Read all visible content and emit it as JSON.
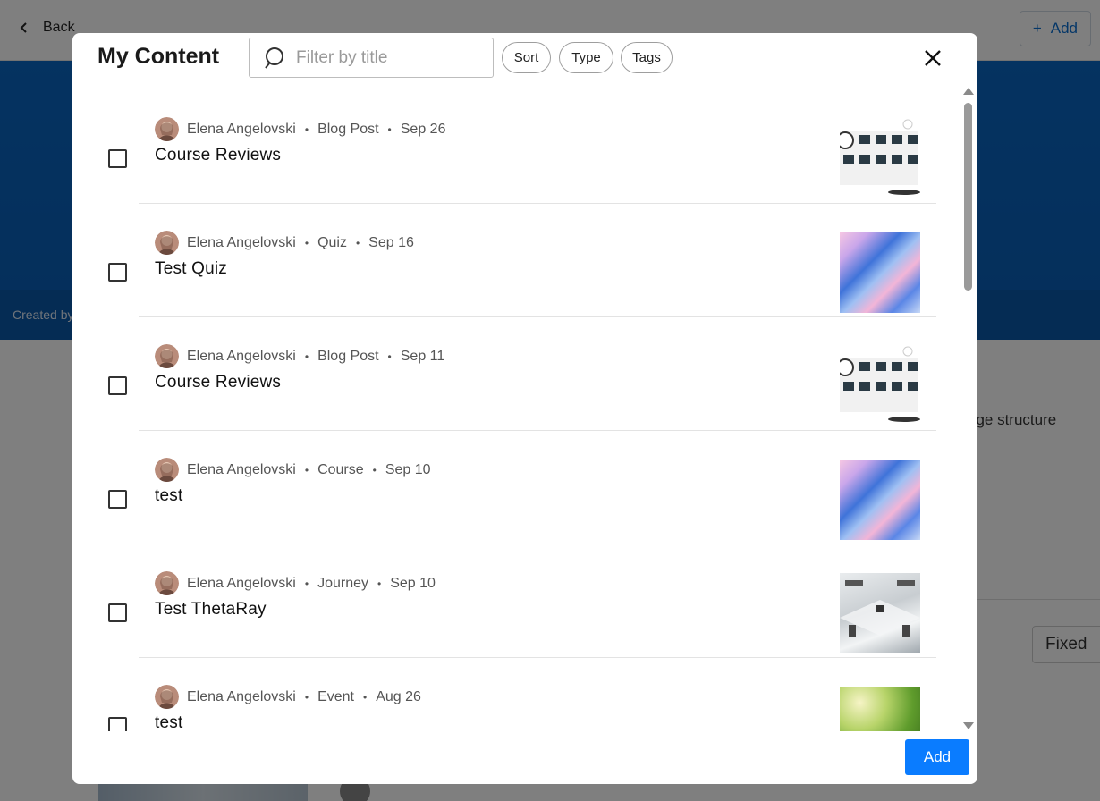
{
  "background": {
    "back_label": "Back",
    "add_label": "Add",
    "created_text": "Created by",
    "right_text": "dge structure",
    "fixed_label": "Fixed"
  },
  "modal": {
    "title": "My Content",
    "search": {
      "placeholder": "Filter by title",
      "value": ""
    },
    "filters": {
      "sort": "Sort",
      "type": "Type",
      "tags": "Tags"
    },
    "add_button": "Add",
    "items": [
      {
        "author": "Elena Angelovski",
        "type": "Blog Post",
        "date": "Sep 26",
        "title": "Course Reviews",
        "thumbnail": "reviews-illustration",
        "checked": false
      },
      {
        "author": "Elena Angelovski",
        "type": "Quiz",
        "date": "Sep 16",
        "title": "Test Quiz",
        "thumbnail": "abstract-wave",
        "checked": false
      },
      {
        "author": "Elena Angelovski",
        "type": "Blog Post",
        "date": "Sep 11",
        "title": "Course Reviews",
        "thumbnail": "reviews-illustration",
        "checked": false
      },
      {
        "author": "Elena Angelovski",
        "type": "Course",
        "date": "Sep 10",
        "title": "test",
        "thumbnail": "abstract-wave",
        "checked": false
      },
      {
        "author": "Elena Angelovski",
        "type": "Journey",
        "date": "Sep 10",
        "title": "Test ThetaRay",
        "thumbnail": "office-photo",
        "checked": false
      },
      {
        "author": "Elena Angelovski",
        "type": "Event",
        "date": "Aug 26",
        "title": "test",
        "thumbnail": "leaf-photo",
        "checked": false
      }
    ]
  },
  "colors": {
    "accent": "#0a7cff",
    "banner": "#0a66c2",
    "overlay": "rgba(0,0,0,0.5)"
  }
}
